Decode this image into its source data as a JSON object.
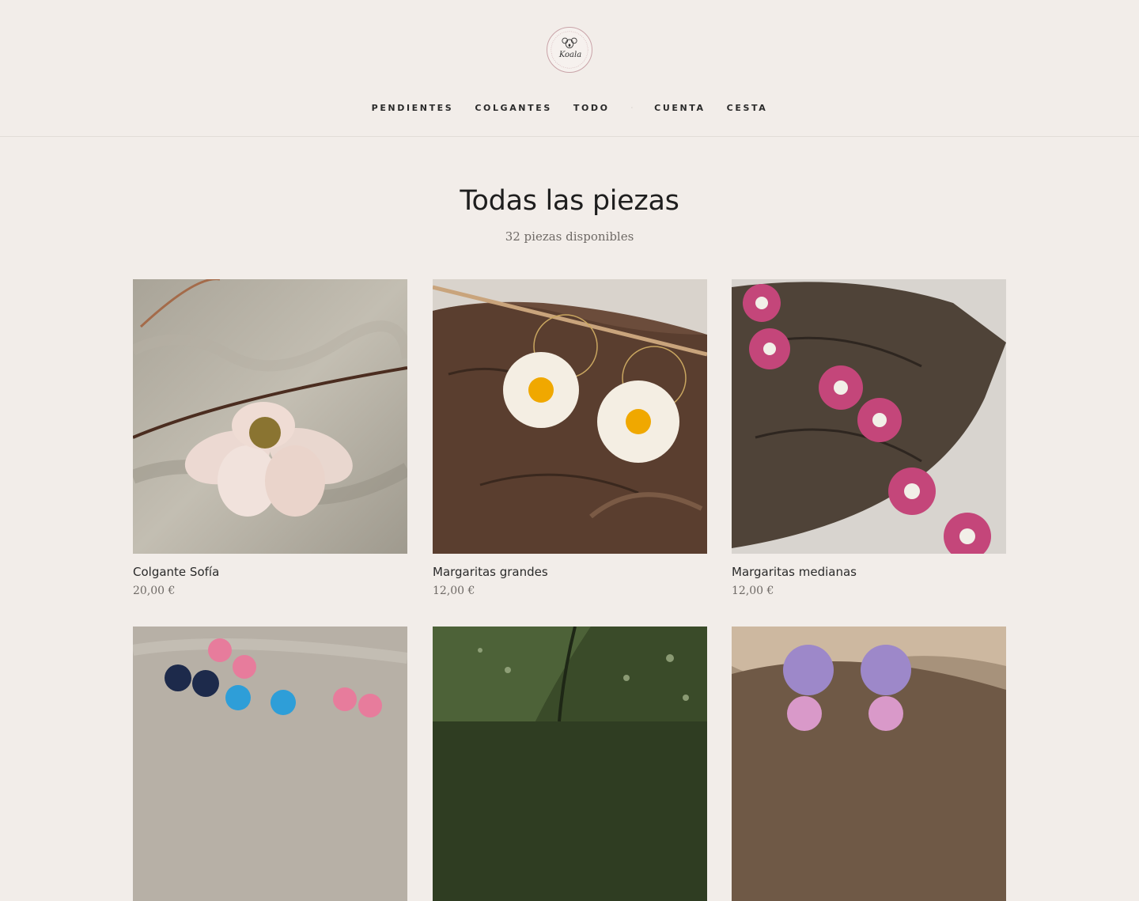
{
  "brand": {
    "logo_text": "Koala"
  },
  "nav": {
    "items": [
      {
        "label": "PENDIENTES"
      },
      {
        "label": "COLGANTES"
      },
      {
        "label": "TODO"
      },
      {
        "label": "CUENTA"
      },
      {
        "label": "CESTA"
      }
    ],
    "separator": "·"
  },
  "page": {
    "title": "Todas las piezas",
    "subtitle": "32 piezas disponibles"
  },
  "products": [
    {
      "name": "Colgante Sofía",
      "price": "20,00 €",
      "image_icon": "flower-pendant-photo"
    },
    {
      "name": "Margaritas grandes",
      "price": "12,00 €",
      "image_icon": "daisy-earrings-photo"
    },
    {
      "name": "Margaritas medianas",
      "price": "12,00 €",
      "image_icon": "pink-daisy-earrings-photo"
    },
    {
      "name": "",
      "price": "",
      "image_icon": "mini-flower-studs-photo"
    },
    {
      "name": "",
      "price": "",
      "image_icon": "leaf-earrings-photo"
    },
    {
      "name": "",
      "price": "",
      "image_icon": "purple-drop-earrings-photo"
    }
  ],
  "colors": {
    "background": "#f2ede9",
    "text": "#222222",
    "muted": "#6f6a66",
    "divider": "#e2dcd7"
  }
}
